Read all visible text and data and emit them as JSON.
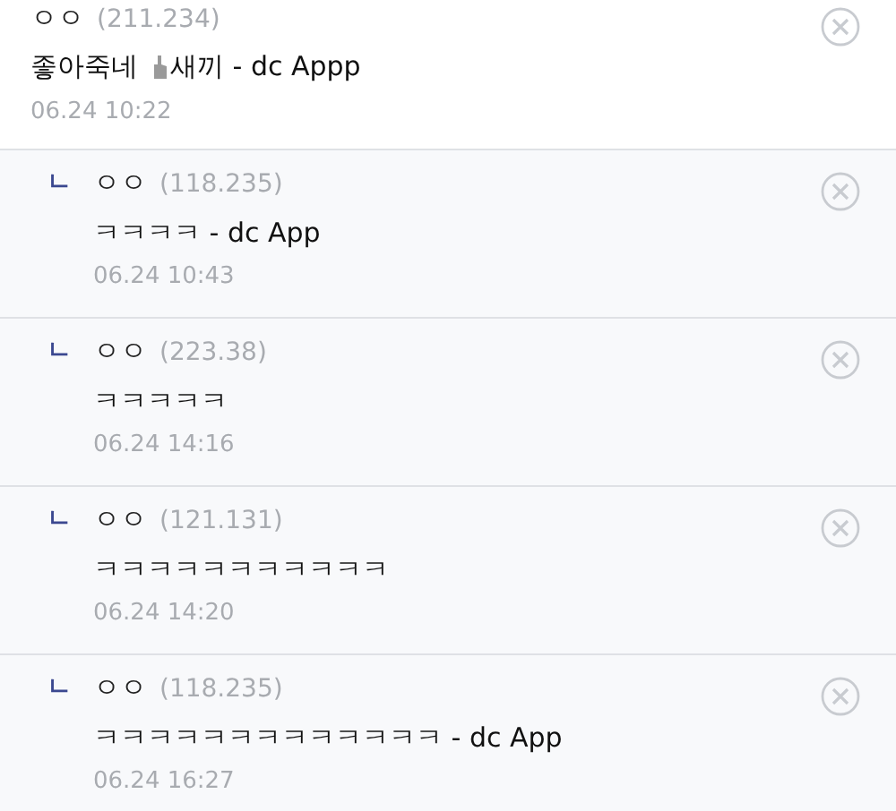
{
  "comment": {
    "author": "ㅇㅇ",
    "ip": "(211.234)",
    "text_before": "좋아죽네",
    "text_after": "새끼 - dc Appp",
    "date": "06.24 10:22"
  },
  "replies": [
    {
      "mark": "ㄴ",
      "author": "ㅇㅇ",
      "ip": "(118.235)",
      "text": "ㅋㅋㅋㅋ - dc App",
      "date": "06.24 10:43"
    },
    {
      "mark": "ㄴ",
      "author": "ㅇㅇ",
      "ip": "(223.38)",
      "text": "ㅋㅋㅋㅋㅋ",
      "date": "06.24 14:16"
    },
    {
      "mark": "ㄴ",
      "author": "ㅇㅇ",
      "ip": "(121.131)",
      "text": "ㅋㅋㅋㅋㅋㅋㅋㅋㅋㅋㅋ",
      "date": "06.24 14:20"
    },
    {
      "mark": "ㄴ",
      "author": "ㅇㅇ",
      "ip": "(118.235)",
      "text": "ㅋㅋㅋㅋㅋㅋㅋㅋㅋㅋㅋㅋㅋ - dc App",
      "date": "06.24 16:27"
    }
  ]
}
